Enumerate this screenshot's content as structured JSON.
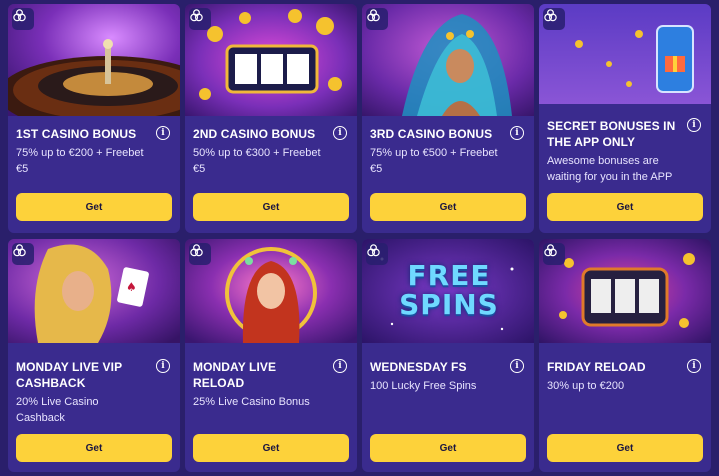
{
  "cards": [
    {
      "title": "1ST CASINO BONUS",
      "desc": "75% up to €200 + Freebet €5",
      "button": "Get",
      "image": "roulette-wheel"
    },
    {
      "title": "2ND CASINO BONUS",
      "desc": "50% up to €300 + Freebet €5",
      "button": "Get",
      "image": "slot-reels-777-coins"
    },
    {
      "title": "3RD CASINO BONUS",
      "desc": "75% up to €500 + Freebet €5",
      "button": "Get",
      "image": "carnival-dancer"
    },
    {
      "title": "SECRET BONUSES IN THE APP ONLY",
      "desc": "Awesome bonuses are waiting for you in the APP",
      "button": "Get",
      "image": "phone-gift"
    },
    {
      "title": "MONDAY LIVE VIP CASHBACK",
      "desc": "20% Live Casino Cashback",
      "button": "Get",
      "image": "woman-ace-card"
    },
    {
      "title": "MONDAY LIVE RELOAD",
      "desc": "25% Live Casino Bonus",
      "button": "Get",
      "image": "red-hair-woman-wreath"
    },
    {
      "title": "WEDNESDAY FS",
      "desc": "100 Lucky Free Spins",
      "button": "Get",
      "image": "free-spins-logo",
      "hero_text": "FREE SPINS"
    },
    {
      "title": "FRIDAY RELOAD",
      "desc": "30% up to €200",
      "button": "Get",
      "image": "slot-machine-777"
    }
  ],
  "colors": {
    "page_bg": "#2a1f6b",
    "card_bg": "#3a2b8e",
    "button": "#fdd23a",
    "button_text": "#1a1440"
  },
  "info_glyph": "i"
}
